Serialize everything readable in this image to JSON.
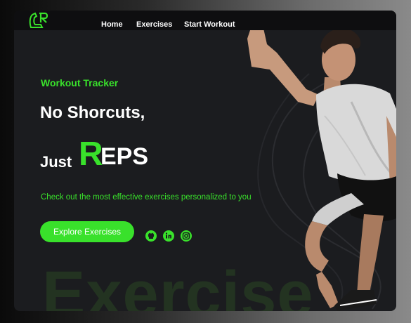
{
  "nav": {
    "links": [
      {
        "label": "Home"
      },
      {
        "label": "Exercises"
      },
      {
        "label": "Start Workout"
      }
    ]
  },
  "hero": {
    "eyebrow": "Workout Tracker",
    "headline_line1": "No Shorcuts,",
    "headline_just": "Just",
    "headline_r": "R",
    "headline_eps": "EPS",
    "tagline": "Check out the most effective exercises personalized to you",
    "cta_label": "Explore Exercises",
    "background_word": "Exercise"
  },
  "social": [
    "github-icon",
    "linkedin-icon",
    "instagram-icon"
  ],
  "colors": {
    "accent": "#39e12b",
    "card": "#1b1c1f",
    "topbar": "#0e0e10"
  }
}
